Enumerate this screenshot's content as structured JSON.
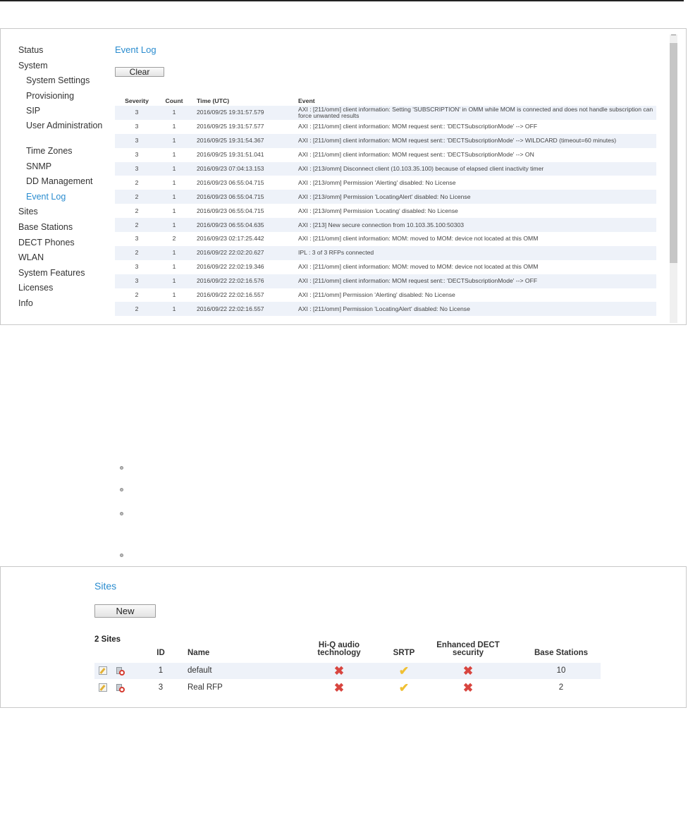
{
  "event_log": {
    "title": "Event Log",
    "clear_label": "Clear",
    "nav": [
      {
        "label": "Status",
        "sub": false
      },
      {
        "label": "System",
        "sub": false
      },
      {
        "label": "System Settings",
        "sub": true
      },
      {
        "label": "Provisioning",
        "sub": true
      },
      {
        "label": "SIP",
        "sub": true
      },
      {
        "label": "User Administration",
        "sub": true
      },
      {
        "label": "Time Zones",
        "sub": true
      },
      {
        "label": "SNMP",
        "sub": true
      },
      {
        "label": "DD Management",
        "sub": true
      },
      {
        "label": "Event Log",
        "sub": true,
        "active": true
      },
      {
        "label": "Sites",
        "sub": false
      },
      {
        "label": "Base Stations",
        "sub": false
      },
      {
        "label": "DECT Phones",
        "sub": false
      },
      {
        "label": "WLAN",
        "sub": false
      },
      {
        "label": "System Features",
        "sub": false
      },
      {
        "label": "Licenses",
        "sub": false
      },
      {
        "label": "Info",
        "sub": false
      }
    ],
    "columns": {
      "severity": "Severity",
      "count": "Count",
      "time": "Time (UTC)",
      "event": "Event"
    },
    "rows": [
      {
        "severity": "3",
        "count": "1",
        "time": "2016/09/25 19:31:57.579",
        "event": "AXI : [211/omm] client information: Setting 'SUBSCRIPTION' in OMM while MOM is connected and does not handle subscription can force unwanted results"
      },
      {
        "severity": "3",
        "count": "1",
        "time": "2016/09/25 19:31:57.577",
        "event": "AXI : [211/omm] client information: MOM request sent:: 'DECTSubscriptionMode' --> OFF"
      },
      {
        "severity": "3",
        "count": "1",
        "time": "2016/09/25 19:31:54.367",
        "event": "AXI : [211/omm] client information: MOM request sent:: 'DECTSubscriptionMode' --> WILDCARD (timeout=60 minutes)"
      },
      {
        "severity": "3",
        "count": "1",
        "time": "2016/09/25 19:31:51.041",
        "event": "AXI : [211/omm] client information: MOM request sent:: 'DECTSubscriptionMode' --> ON"
      },
      {
        "severity": "3",
        "count": "1",
        "time": "2016/09/23 07:04:13.153",
        "event": "AXI : [213/omm] Disconnect client (10.103.35.100) because of elapsed client inactivity timer"
      },
      {
        "severity": "2",
        "count": "1",
        "time": "2016/09/23 06:55:04.715",
        "event": "AXI : [213/omm] Permission 'Alerting' disabled: No License"
      },
      {
        "severity": "2",
        "count": "1",
        "time": "2016/09/23 06:55:04.715",
        "event": "AXI : [213/omm] Permission 'LocatingAlert' disabled: No License"
      },
      {
        "severity": "2",
        "count": "1",
        "time": "2016/09/23 06:55:04.715",
        "event": "AXI : [213/omm] Permission 'Locating' disabled: No License"
      },
      {
        "severity": "2",
        "count": "1",
        "time": "2016/09/23 06:55:04.635",
        "event": "AXI : [213] New secure connection from 10.103.35.100:50303"
      },
      {
        "severity": "3",
        "count": "2",
        "time": "2016/09/23 02:17:25.442",
        "event": "AXI : [211/omm] client information: MOM: moved to MOM: device not located at this OMM"
      },
      {
        "severity": "2",
        "count": "1",
        "time": "2016/09/22 22:02:20.627",
        "event": "IPL : 3 of 3 RFPs connected"
      },
      {
        "severity": "3",
        "count": "1",
        "time": "2016/09/22 22:02:19.346",
        "event": "AXI : [211/omm] client information: MOM: moved to MOM: device not located at this OMM"
      },
      {
        "severity": "3",
        "count": "1",
        "time": "2016/09/22 22:02:16.576",
        "event": "AXI : [211/omm] client information: MOM request sent:: 'DECTSubscriptionMode' --> OFF"
      },
      {
        "severity": "2",
        "count": "1",
        "time": "2016/09/22 22:02:16.557",
        "event": "AXI : [211/omm] Permission 'Alerting' disabled: No License"
      },
      {
        "severity": "2",
        "count": "1",
        "time": "2016/09/22 22:02:16.557",
        "event": "AXI : [211/omm] Permission 'LocatingAlert' disabled: No License"
      }
    ]
  },
  "sites": {
    "title": "Sites",
    "new_label": "New",
    "count_label": "2 Sites",
    "columns": {
      "id": "ID",
      "name": "Name",
      "hiq": "Hi-Q audio technology",
      "srtp": "SRTP",
      "enhanced": "Enhanced DECT security",
      "base": "Base Stations"
    },
    "rows": [
      {
        "id": "1",
        "name": "default",
        "hiq": "✖",
        "srtp": "✔",
        "enhanced": "✖",
        "base": "10"
      },
      {
        "id": "3",
        "name": "Real RFP",
        "hiq": "✖",
        "srtp": "✔",
        "enhanced": "✖",
        "base": "2"
      }
    ]
  }
}
